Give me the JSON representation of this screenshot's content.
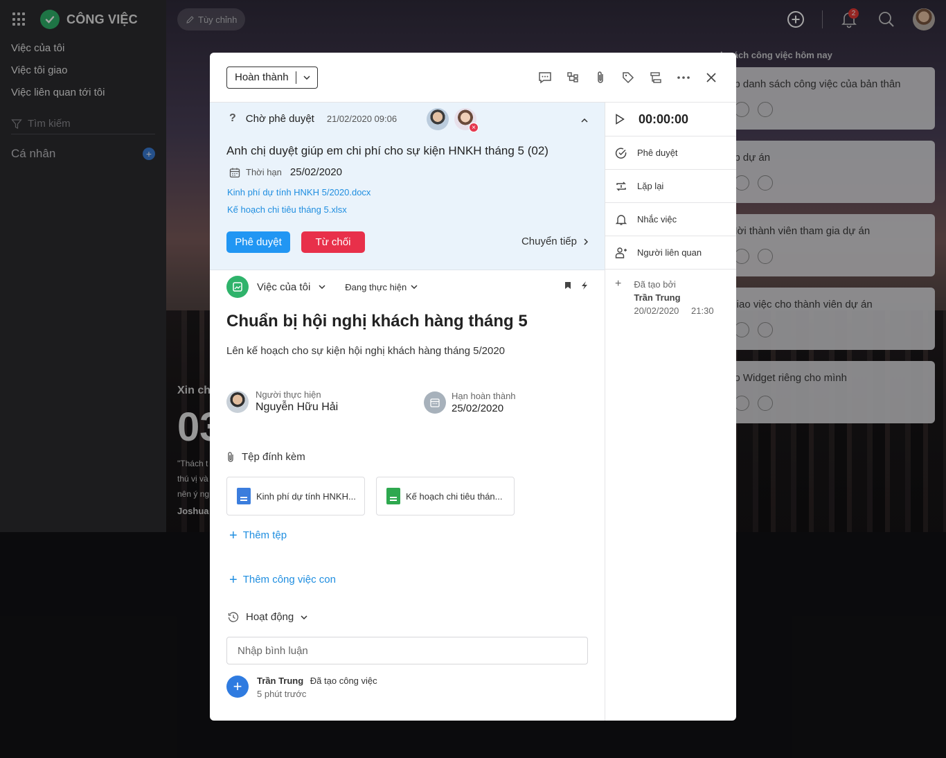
{
  "app": {
    "name": "CÔNG VIỆC",
    "customize_label": "Tùy chỉnh",
    "notification_count": "2"
  },
  "sidebar": {
    "items": [
      {
        "label": "Việc của tôi"
      },
      {
        "label": "Việc tôi giao"
      },
      {
        "label": "Việc liên quan tới tôi"
      }
    ],
    "search_placeholder": "Tìm kiếm",
    "section_label": "Cá nhân"
  },
  "background": {
    "greeting": "Xin chà",
    "clock": "03",
    "quote": "\"Thách t thú vị và nên ý ng",
    "author": "Joshua",
    "today_list_title": "h sách công việc hôm nay",
    "today_tasks": [
      {
        "label": "ập danh sách công việc của bản thân"
      },
      {
        "label": "ập dự án"
      },
      {
        "label": "Mời thành viên tham gia dự án"
      },
      {
        "label": "Giao việc cho thành viên dự án"
      },
      {
        "label": "ạo Widget riêng cho mình"
      }
    ]
  },
  "modal": {
    "status_select": "Hoàn thành",
    "approval": {
      "status": "Chờ phê duyệt",
      "datetime": "21/02/2020  09:06",
      "title": "Anh chị duyệt giúp em chi phí cho sự kiện HNKH tháng 5 (02)",
      "due_label": "Thời hạn",
      "due_value": "25/02/2020",
      "links": [
        "Kinh phí dự tính HNKH 5/2020.docx",
        "Kế hoạch chi tiêu tháng 5.xlsx"
      ],
      "approve_label": "Phê duyệt",
      "reject_label": "Từ chối",
      "forward_label": "Chuyển tiếp"
    },
    "task": {
      "project": "Việc của tôi",
      "status": "Đang thực hiện",
      "title": "Chuẩn bị hội nghị khách hàng tháng 5",
      "description": "Lên kế hoạch cho sự kiện hội nghị khách hàng tháng 5/2020",
      "assignee_label": "Người thực hiện",
      "assignee_name": "Nguyễn Hữu Hải",
      "deadline_label": "Hạn hoàn thành",
      "deadline_value": "25/02/2020",
      "attachments_label": "Tệp đính kèm",
      "attachments": [
        {
          "name": "Kinh phí dự tính HNKH...",
          "color": "#3b7ddd"
        },
        {
          "name": "Kế hoạch chi tiêu thán...",
          "color": "#2ea84f"
        }
      ],
      "add_file_label": "Thêm tệp",
      "add_subtask_label": "Thêm công việc con",
      "activity_label": "Hoạt động",
      "comment_placeholder": "Nhập bình luận",
      "log": {
        "user": "Trần Trung",
        "action": "Đã tạo công việc",
        "time": "5 phút trước"
      }
    },
    "side": {
      "timer": "00:00:00",
      "items": [
        {
          "label": "Phê duyệt"
        },
        {
          "label": "Lặp lại"
        },
        {
          "label": "Nhắc việc"
        },
        {
          "label": "Người liên quan"
        }
      ],
      "created_label": "Đã tạo bởi",
      "created_by": "Trần Trung",
      "created_date": "20/02/2020",
      "created_time": "21:30"
    }
  },
  "colors": {
    "accent": "#2196f3",
    "reject": "#e8304a",
    "brand": "#2fb36b",
    "link": "#1f8ee0"
  }
}
